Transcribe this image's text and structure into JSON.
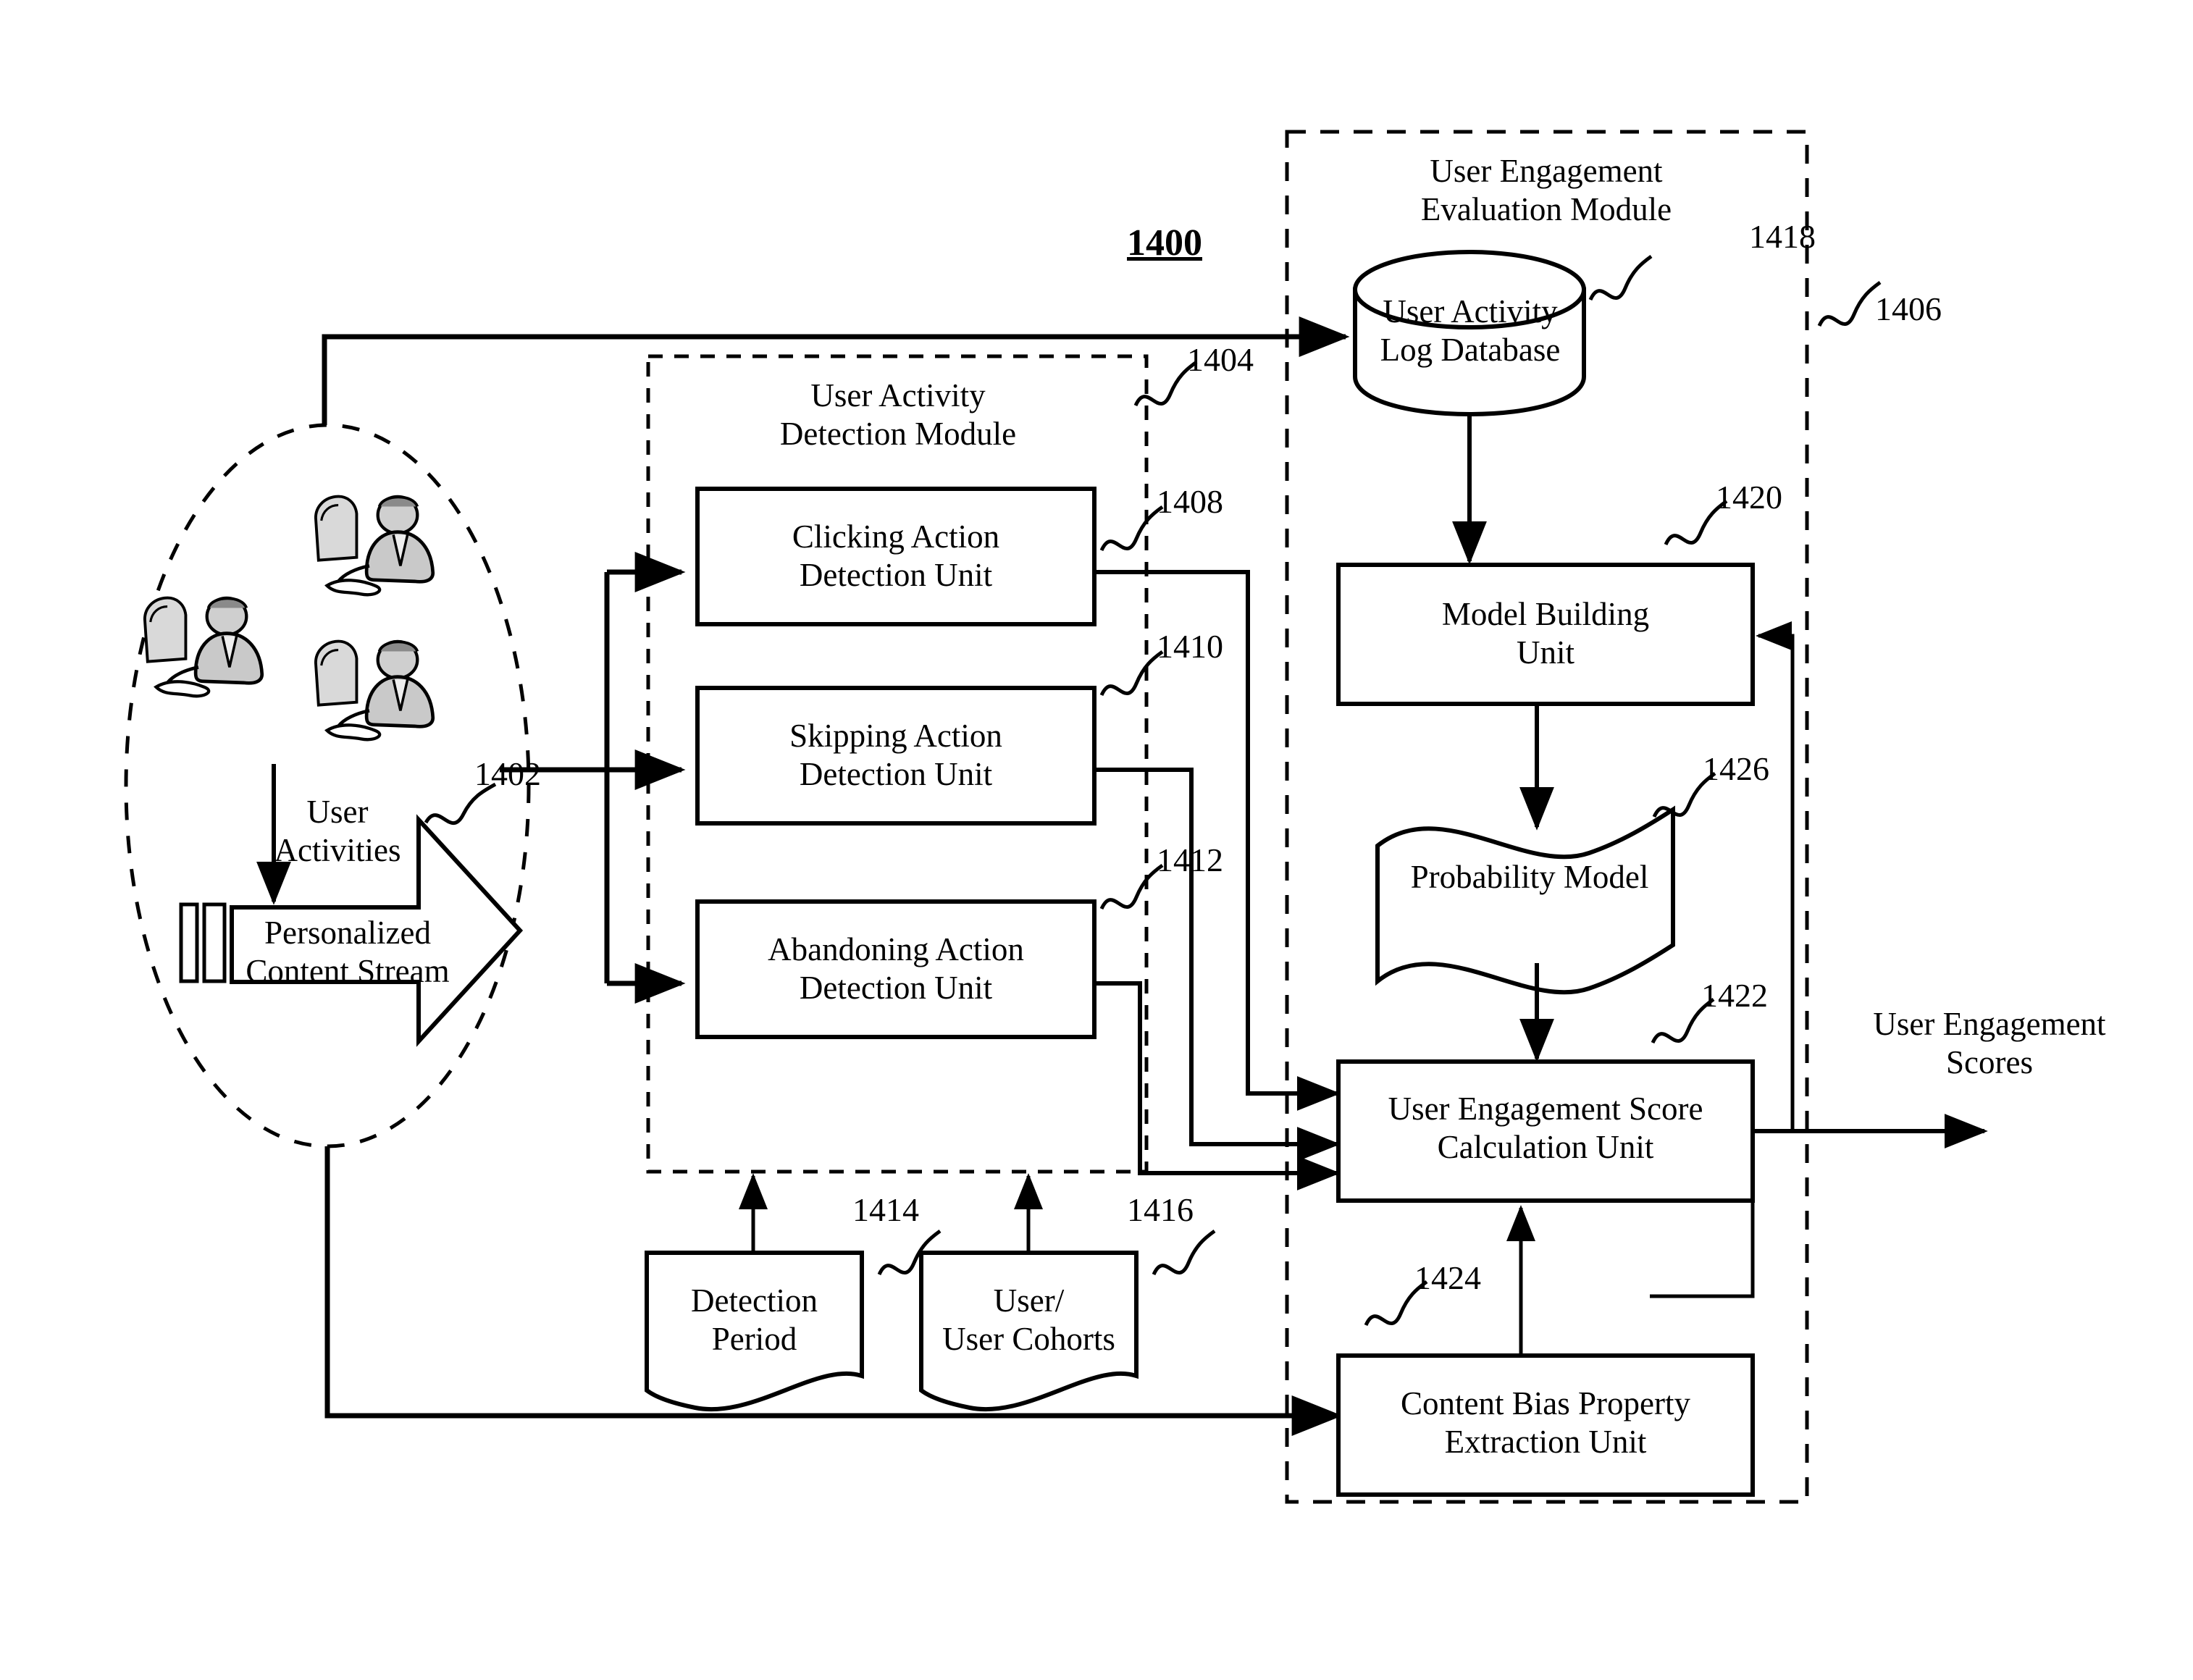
{
  "figure": {
    "number": "1400"
  },
  "source": {
    "ellipse_label": "User\nActivities",
    "stream_label": "Personalized\nContent Stream",
    "stream_ref": "1402",
    "people_icon": "users-at-computers-icon"
  },
  "detection_module": {
    "title": "User Activity\nDetection Module",
    "ref": "1404",
    "units": [
      {
        "label": "Clicking Action\nDetection Unit",
        "ref": "1408"
      },
      {
        "label": "Skipping Action\nDetection Unit",
        "ref": "1410"
      },
      {
        "label": "Abandoning Action\nDetection Unit",
        "ref": "1412"
      }
    ]
  },
  "parameters": [
    {
      "label": "Detection\nPeriod",
      "ref": "1414"
    },
    {
      "label": "User/\nUser Cohorts",
      "ref": "1416"
    }
  ],
  "evaluation_module": {
    "title": "User Engagement\nEvaluation Module",
    "ref": "1406",
    "database": {
      "label": "User Activity\nLog Database",
      "ref": "1418"
    },
    "model_builder": {
      "label": "Model Building\nUnit",
      "ref": "1420"
    },
    "probability_model": {
      "label": "Probability Model",
      "ref": "1426"
    },
    "score_unit": {
      "label": "User Engagement Score\nCalculation Unit",
      "ref": "1422"
    },
    "bias_unit": {
      "label": "Content Bias Property\nExtraction Unit",
      "ref": "1424"
    }
  },
  "output": {
    "label": "User Engagement\nScores"
  },
  "colors": {
    "ink": "#000000",
    "paper": "#ffffff"
  }
}
